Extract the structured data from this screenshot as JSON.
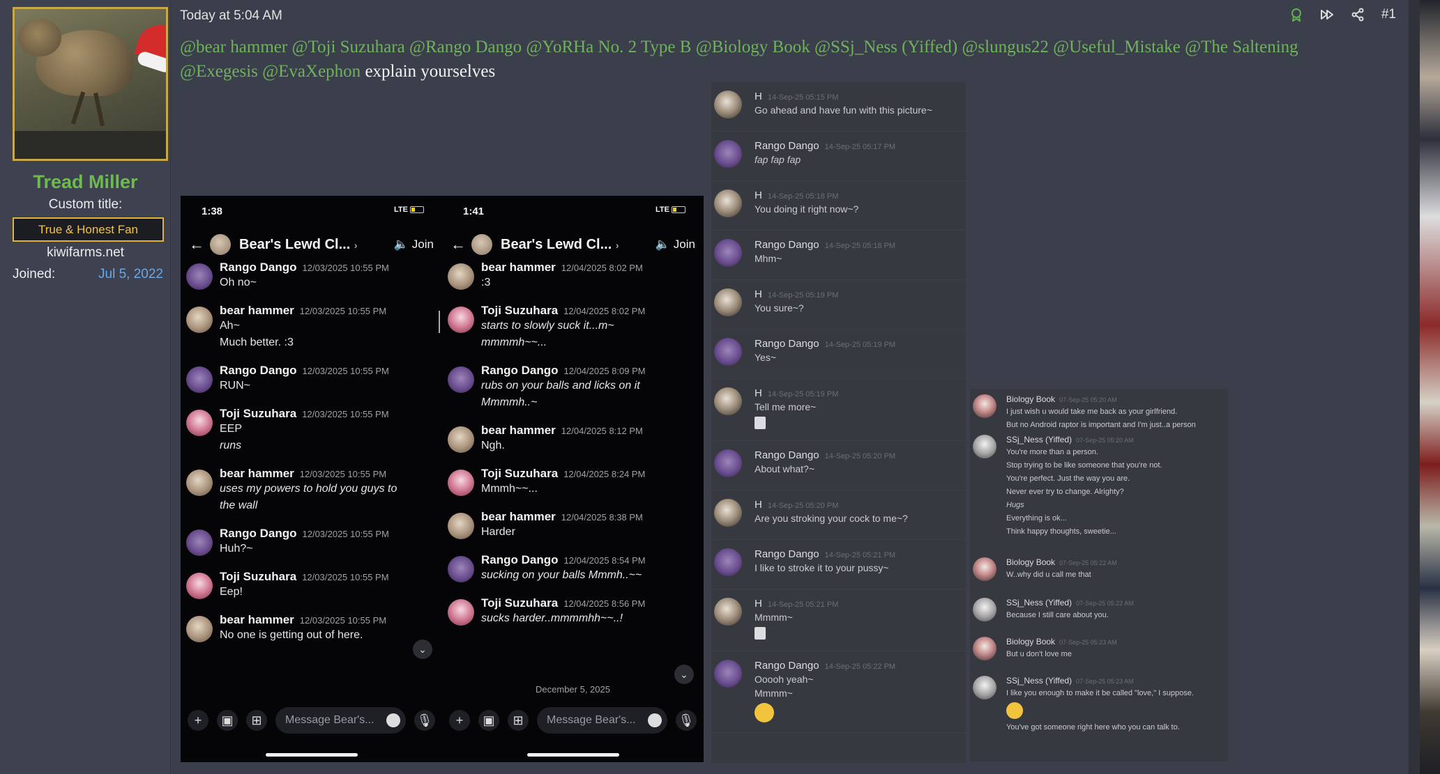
{
  "user": {
    "name": "Tread Miller",
    "custom_title_label": "Custom title:",
    "custom_title": "True & Honest Fan",
    "site": "kiwifarms.net",
    "joined_label": "Joined:",
    "joined_value": "Jul 5, 2022"
  },
  "post": {
    "timestamp": "Today at 5:04 AM",
    "number": "#1",
    "mentions": [
      "@bear hammer",
      "@Toji Suzuhara",
      "@Rango Dango",
      "@YoRHa No. 2 Type B",
      "@Biology Book",
      "@SSj_Ness (Yiffed)",
      "@slungus22",
      "@Useful_Mistake",
      "@The Saltening",
      "@Exegesis",
      "@EvaXephon"
    ],
    "text_after": "explain yourselves"
  },
  "phone_left": {
    "time": "1:38",
    "signal": "LTE",
    "back": "←",
    "channel": "Bear's Lewd Cl...",
    "chevron": "›",
    "join": "🔈 Join",
    "messages": [
      {
        "name": "Rango Dango",
        "time": "12/03/2025 10:55 PM",
        "lines": [
          "Oh no~"
        ],
        "av": "rango"
      },
      {
        "name": "bear hammer",
        "time": "12/03/2025 10:55 PM",
        "lines": [
          "Ah~",
          "Much better. :3"
        ],
        "av": "bear"
      },
      {
        "name": "Rango Dango",
        "time": "12/03/2025 10:55 PM",
        "lines": [
          "RUN~"
        ],
        "av": "rango"
      },
      {
        "name": "Toji Suzuhara",
        "time": "12/03/2025 10:55 PM",
        "lines": [
          "EEP",
          "runs"
        ],
        "av": "toji",
        "italic_from": 1
      },
      {
        "name": "bear hammer",
        "time": "12/03/2025 10:55 PM",
        "lines": [
          "uses my powers to hold you guys to",
          "the wall"
        ],
        "av": "bear",
        "italic_from": 0
      },
      {
        "name": "Rango Dango",
        "time": "12/03/2025 10:55 PM",
        "lines": [
          "Huh?~"
        ],
        "av": "rango"
      },
      {
        "name": "Toji Suzuhara",
        "time": "12/03/2025 10:55 PM",
        "lines": [
          "Eep!"
        ],
        "av": "toji"
      },
      {
        "name": "bear hammer",
        "time": "12/03/2025 10:55 PM",
        "lines": [
          "No one is getting out of here."
        ],
        "av": "bear"
      }
    ],
    "input_placeholder": "Message Bear's..."
  },
  "phone_right": {
    "time": "1:41",
    "signal": "LTE",
    "back": "←",
    "channel": "Bear's Lewd Cl...",
    "chevron": "›",
    "join": "🔈 Join",
    "messages": [
      {
        "name": "bear hammer",
        "time": "12/04/2025 8:02 PM",
        "lines": [
          ":3"
        ],
        "av": "bear"
      },
      {
        "name": "Toji Suzuhara",
        "time": "12/04/2025 8:02 PM",
        "lines": [
          "starts to slowly suck it...m~",
          "mmmmh~~..."
        ],
        "av": "toji",
        "italic_from": 0
      },
      {
        "name": "Rango Dango",
        "time": "12/04/2025 8:09 PM",
        "lines": [
          "rubs on your balls and licks on it",
          "Mmmmh..~"
        ],
        "av": "rango",
        "italic_from": 0
      },
      {
        "name": "bear hammer",
        "time": "12/04/2025 8:12 PM",
        "lines": [
          "Ngh."
        ],
        "av": "bear"
      },
      {
        "name": "Toji Suzuhara",
        "time": "12/04/2025 8:24 PM",
        "lines": [
          "Mmmh~~..."
        ],
        "av": "toji"
      },
      {
        "name": "bear hammer",
        "time": "12/04/2025 8:38 PM",
        "lines": [
          "Harder"
        ],
        "av": "bear"
      },
      {
        "name": "Rango Dango",
        "time": "12/04/2025 8:54 PM",
        "lines": [
          "sucking on your balls Mmmh..~~"
        ],
        "av": "rango",
        "italic_from": 0
      },
      {
        "name": "Toji Suzuhara",
        "time": "12/04/2025 8:56 PM",
        "lines": [
          "sucks harder..mmmmhh~~..!"
        ],
        "av": "toji",
        "italic_from": 0
      }
    ],
    "date_divider": "December 5, 2025",
    "input_placeholder": "Message Bear's..."
  },
  "log1": [
    {
      "name": "H",
      "time": "14-Sep-25 05:15 PM",
      "lines": [
        "Go ahead and have fun with this picture~"
      ],
      "av": "h"
    },
    {
      "name": "Rango Dango",
      "time": "14-Sep-25 05:17 PM",
      "lines": [
        "fap fap fap"
      ],
      "av": "rango",
      "italic": true
    },
    {
      "name": "H",
      "time": "14-Sep-25 05:18 PM",
      "lines": [
        "You doing it right now~?"
      ],
      "av": "h"
    },
    {
      "name": "Rango Dango",
      "time": "14-Sep-25 05:18 PM",
      "lines": [
        "Mhm~"
      ],
      "av": "rango"
    },
    {
      "name": "H",
      "time": "14-Sep-25 05:19 PM",
      "lines": [
        "You sure~?"
      ],
      "av": "h"
    },
    {
      "name": "Rango Dango",
      "time": "14-Sep-25 05:19 PM",
      "lines": [
        "Yes~"
      ],
      "av": "rango"
    },
    {
      "name": "H",
      "time": "14-Sep-25 05:19 PM",
      "lines": [
        "Tell me more~"
      ],
      "av": "h",
      "file": true
    },
    {
      "name": "Rango Dango",
      "time": "14-Sep-25 05:20 PM",
      "lines": [
        "About what?~"
      ],
      "av": "rango"
    },
    {
      "name": "H",
      "time": "14-Sep-25 05:20 PM",
      "lines": [
        "Are you stroking your cock to me~?"
      ],
      "av": "h"
    },
    {
      "name": "Rango Dango",
      "time": "14-Sep-25 05:21 PM",
      "lines": [
        "I like to stroke it to your pussy~"
      ],
      "av": "rango"
    },
    {
      "name": "H",
      "time": "14-Sep-25 05:21 PM",
      "lines": [
        "Mmmm~"
      ],
      "av": "h",
      "file": true
    },
    {
      "name": "Rango Dango",
      "time": "14-Sep-25 05:22 PM",
      "lines": [
        "Ooooh yeah~",
        "Mmmm~"
      ],
      "av": "rango",
      "emoji": true
    }
  ],
  "log2": [
    {
      "name": "Biology Book",
      "time": "07-Sep-25 05:20 AM",
      "lines": [
        "I just wish u would take me back as your girlfriend.",
        "But no Android raptor is important and I'm just..a person"
      ],
      "av": "bio"
    },
    {
      "name": "SSj_Ness (Yiffed)",
      "time": "07-Sep-25 05:20 AM",
      "lines": [
        "You're more than a person.",
        "Stop trying to be like someone that you're not.",
        "You're perfect. Just the way you are.",
        "Never ever try to change. Alrighty?",
        "Hugs",
        "Everything is ok...",
        "Think happy thoughts, sweetie..."
      ],
      "av": "ssj",
      "italic_lines": [
        4
      ]
    },
    {
      "name": "Biology Book",
      "time": "07-Sep-25 05:22 AM",
      "lines": [
        "W..why did u call me that"
      ],
      "av": "bio"
    },
    {
      "name": "SSj_Ness (Yiffed)",
      "time": "07-Sep-25 05:22 AM",
      "lines": [
        "Because I still care about you."
      ],
      "av": "ssj"
    },
    {
      "name": "Biology Book",
      "time": "07-Sep-25 05:23 AM",
      "lines": [
        "But u don't love me"
      ],
      "av": "bio"
    },
    {
      "name": "SSj_Ness (Yiffed)",
      "time": "07-Sep-25 05:23 AM",
      "lines": [
        "I like you enough to make it be called \"love,\" I suppose.",
        "You've got someone right here who you can talk to."
      ],
      "av": "ssj",
      "emoji_after": 0
    }
  ]
}
